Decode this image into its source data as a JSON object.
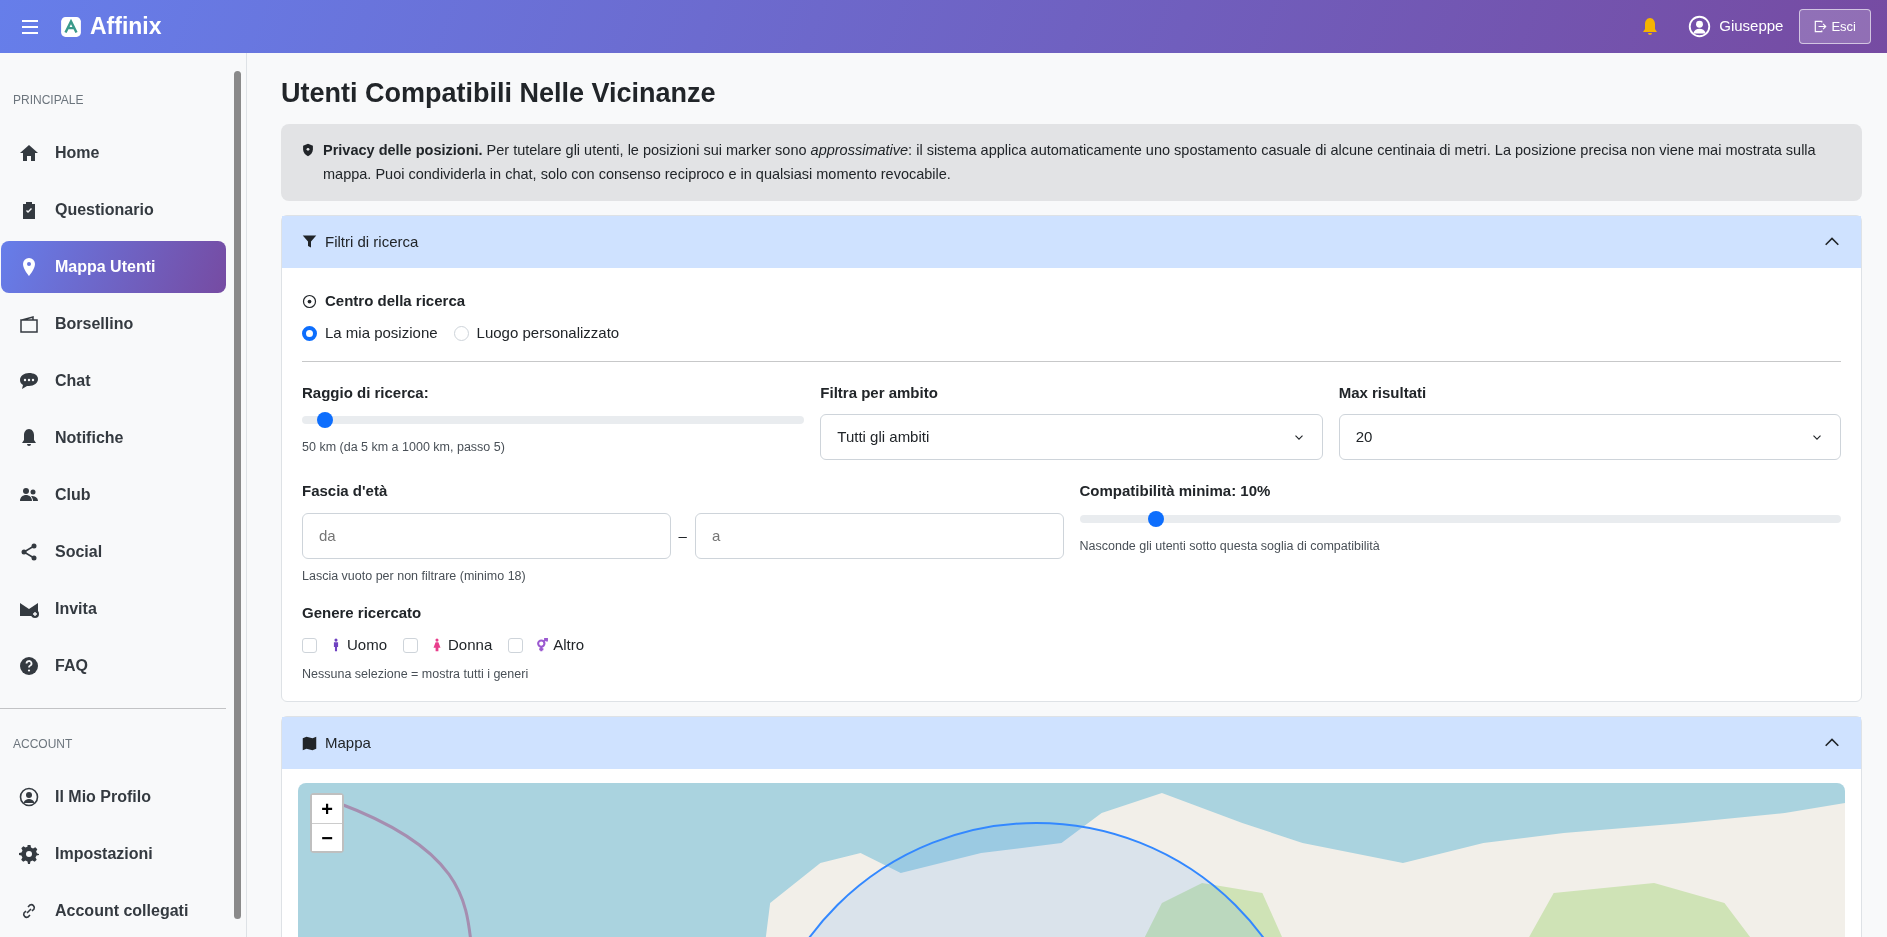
{
  "topbar": {
    "brand": "Affinix",
    "user": "Giuseppe",
    "logout": "Esci"
  },
  "sidebar": {
    "sections": [
      {
        "title": "PRINCIPALE",
        "items": [
          {
            "label": "Home",
            "selected": false
          },
          {
            "label": "Questionario",
            "selected": false
          },
          {
            "label": "Mappa Utenti",
            "selected": true
          },
          {
            "label": "Borsellino",
            "selected": false
          },
          {
            "label": "Chat",
            "selected": false
          },
          {
            "label": "Notifiche",
            "selected": false
          },
          {
            "label": "Club",
            "selected": false
          },
          {
            "label": "Social",
            "selected": false
          },
          {
            "label": "Invita",
            "selected": false
          },
          {
            "label": "FAQ",
            "selected": false
          }
        ]
      },
      {
        "title": "ACCOUNT",
        "items": [
          {
            "label": "Il Mio Profilo",
            "selected": false
          },
          {
            "label": "Impostazioni",
            "selected": false
          },
          {
            "label": "Account collegati",
            "selected": false
          }
        ]
      }
    ]
  },
  "page_title": "Utenti Compatibili Nelle Vicinanze",
  "privacy_notice": "**Privacy delle posizioni.** Per tutelare gli utenti, le posizioni sui marker sono *approssimative*: il sistema applica automaticamente uno spostamento casuale di alcune centinaia di metri. La posizione precisa non viene mai mostrata sulla mappa. Puoi condividerla in chat, solo con consenso reciproco e in qualsiasi momento revocabile.",
  "filters": {
    "header": "Filtri di ricerca",
    "expanded": true,
    "center": {
      "label": "Centro della ricerca",
      "options": [
        {
          "label": "La mia posizione",
          "selected": true
        },
        {
          "label": "Luogo personalizzato",
          "selected": false
        }
      ]
    },
    "radius": {
      "label": "Raggio di ricerca:",
      "level": 0.045,
      "hint": "50 km (da 5 km a 1000 km, passo 5)"
    },
    "scope": {
      "label": "Filtra per ambito",
      "value": "Tutti gli ambiti"
    },
    "max_results": {
      "label": "Max risultati",
      "value": "20"
    },
    "age": {
      "label": "Fascia d'età",
      "from_placeholder": "da",
      "separator": "–",
      "to_placeholder": "a",
      "hint": "Lascia vuoto per non filtrare (minimo 18)"
    },
    "compatibility": {
      "label": "Compatibilità minima: **10%**",
      "level": 0.1,
      "hint": "Nasconde gli utenti sotto questa soglia di compatibilità"
    },
    "gender": {
      "label": "Genere ricercato",
      "options": [
        {
          "label": "Uomo",
          "checked": false,
          "color": "#6f42c1"
        },
        {
          "label": "Donna",
          "checked": false,
          "color": "#e83e8c"
        },
        {
          "label": "Altro",
          "checked": false,
          "color": "#9b59d0"
        }
      ],
      "hint": "Nessuna selezione = mostra tutti i generi"
    }
  },
  "map": {
    "header": "Mappa",
    "expanded": true,
    "zoom_in": "+",
    "zoom_out": "−"
  }
}
